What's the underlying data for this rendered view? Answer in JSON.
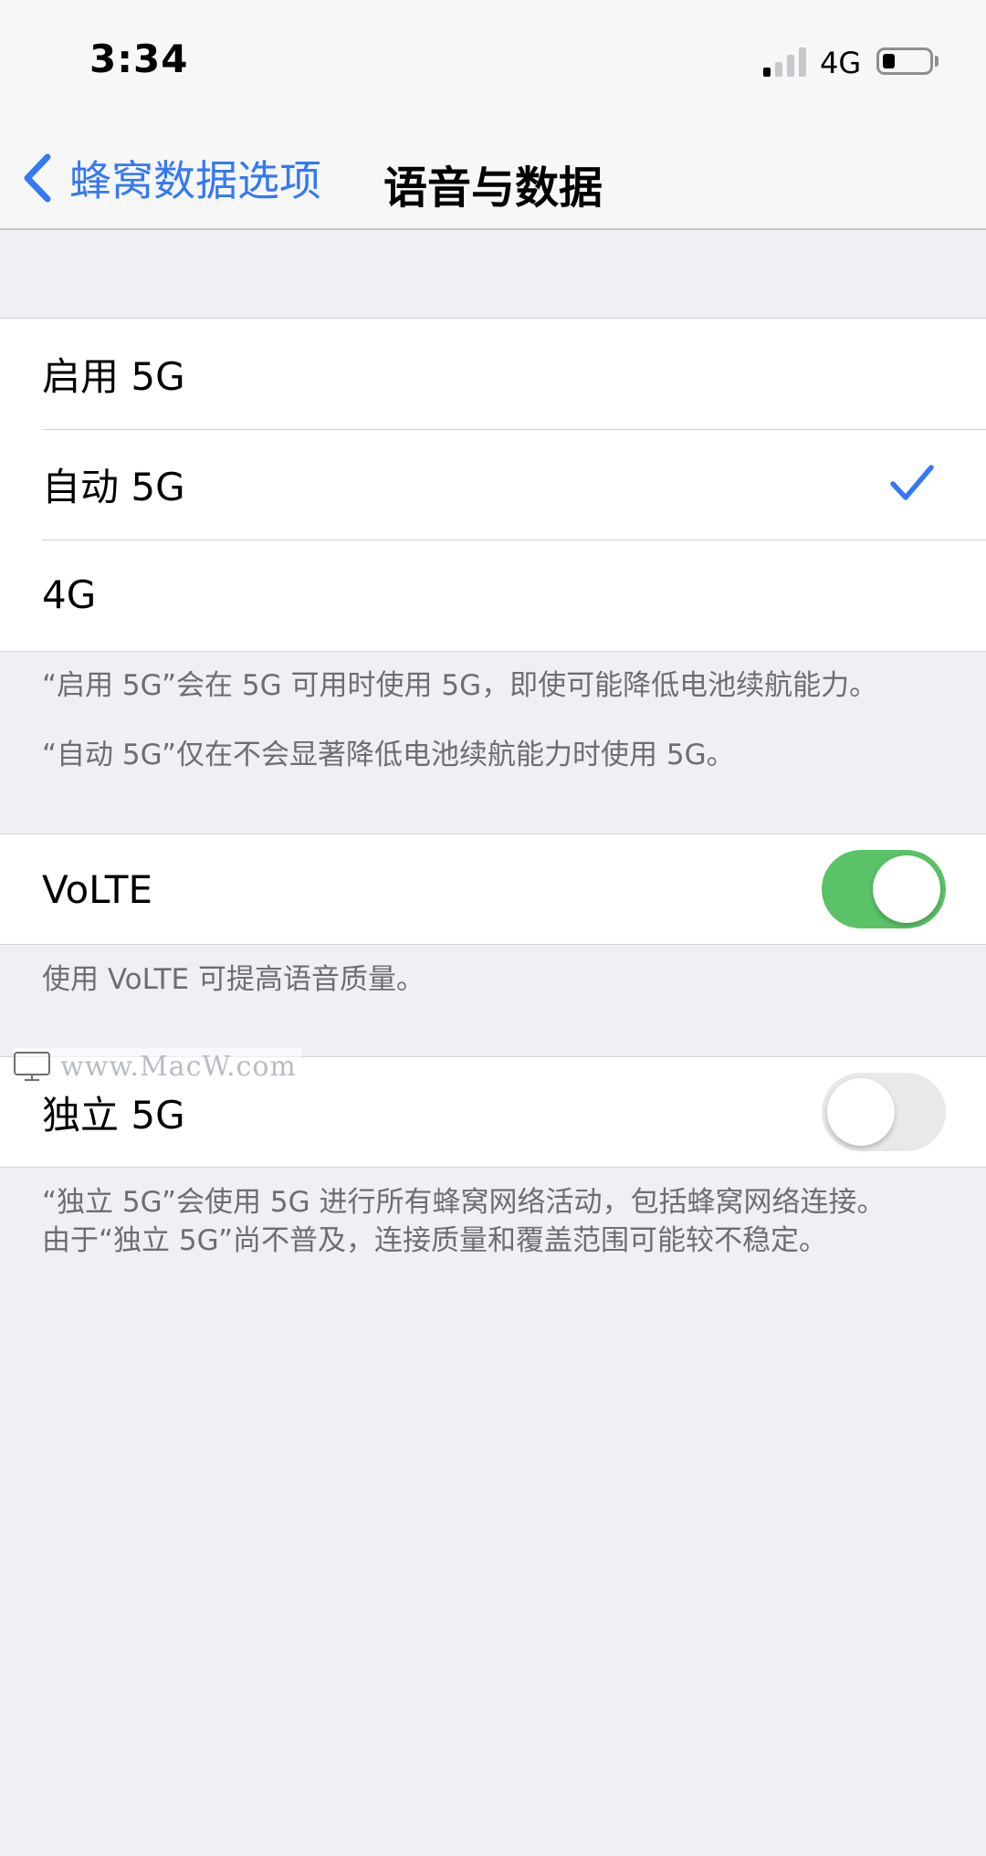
{
  "status_bar": {
    "time": "3:34",
    "network": "4G",
    "signal_bars_active": 1,
    "signal_bars_total": 4,
    "battery_level": 0.2
  },
  "nav": {
    "back_label": "蜂窝数据选项",
    "title": "语音与数据",
    "accent_color": "#3478f6"
  },
  "modes": {
    "items": [
      {
        "label": "启用 5G",
        "selected": false
      },
      {
        "label": "自动 5G",
        "selected": true
      },
      {
        "label": "4G",
        "selected": false
      }
    ],
    "footer_1": "“启用 5G”会在 5G 可用时使用 5G，即使可能降低电池续航能力。",
    "footer_2": "“自动 5G”仅在不会显著降低电池续航能力时使用 5G。"
  },
  "volte": {
    "label": "VoLTE",
    "enabled": true,
    "on_color": "#5ac267",
    "footer": "使用 VoLTE 可提高语音质量。"
  },
  "sa_5g": {
    "label": "独立 5G",
    "enabled": false,
    "footer_line1": "“独立 5G”会使用 5G 进行所有蜂窝网络活动，包括蜂窝网络连接。",
    "footer_line2": "由于“独立 5G”尚不普及，连接质量和覆盖范围可能较不稳定。"
  },
  "watermark": {
    "text": "www.MacW.com",
    "icon": "monitor-icon"
  }
}
